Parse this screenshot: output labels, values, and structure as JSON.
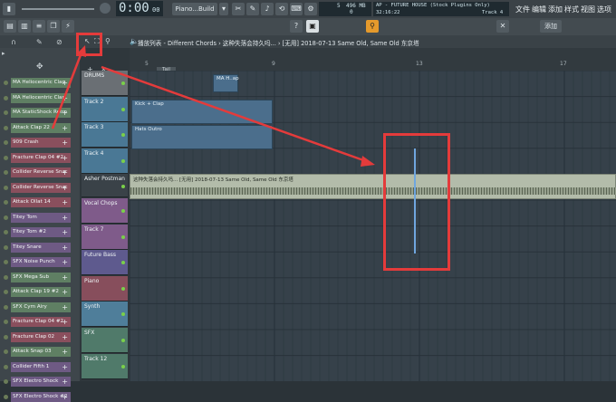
{
  "transport": {
    "time": "0:00",
    "time_sub": "00",
    "pattern": "Piano...Build"
  },
  "stats": {
    "cpu": "5",
    "mem": "496 MB",
    "voices": "0",
    "clock": "32:16:22"
  },
  "hint": {
    "title": "AP - FUTURE HOUSE (Stock Plugins Only)",
    "track": "Track 4"
  },
  "menu": [
    "文件",
    "编辑",
    "添加",
    "样式",
    "视图",
    "选项"
  ],
  "toolbar2": {
    "add_label": "添加"
  },
  "playlist": {
    "breadcrumb": "播放列表 - Different Chords › 这种失落会持久吗... › [无用] 2018-07-13 Same Old, Same Old 东京塔",
    "ruler_marks": [
      "5",
      "9",
      "13",
      "17"
    ],
    "tab_label": "Tail"
  },
  "channels": [
    {
      "name": "MA Heliocentric Clap",
      "color": "#5f7f63"
    },
    {
      "name": "MA Heliocentric Clap",
      "color": "#5f7f63"
    },
    {
      "name": "MA StaticShock Retro",
      "color": "#5f7f63"
    },
    {
      "name": "Attack Clap 22",
      "color": "#5f7f63"
    },
    {
      "name": "909 Crash",
      "color": "#8a4f5d"
    },
    {
      "name": "Fracture Clap 04 #2",
      "color": "#8a4f5d"
    },
    {
      "name": "Collider Reverse Snar",
      "color": "#8a4f5d"
    },
    {
      "name": "Collider Reverse Snar",
      "color": "#8a4f5d"
    },
    {
      "name": "Attack Ollat 14",
      "color": "#8a4f5d"
    },
    {
      "name": "Titey Tom",
      "color": "#6e5a84"
    },
    {
      "name": "Titey Tom #2",
      "color": "#6e5a84"
    },
    {
      "name": "Titey Snare",
      "color": "#6e5a84"
    },
    {
      "name": "SFX Noise Punch",
      "color": "#6e5a84"
    },
    {
      "name": "SFX Mega Sub",
      "color": "#5f7f63"
    },
    {
      "name": "Attack Clap 19 #2",
      "color": "#5f7f63"
    },
    {
      "name": "SFX Cym Airy",
      "color": "#5f7f63"
    },
    {
      "name": "Fracture Clap 04 #2",
      "color": "#8a4f5d"
    },
    {
      "name": "Fracture Clap 02",
      "color": "#8a4f5d"
    },
    {
      "name": "Attack Snap 03",
      "color": "#5f7f63"
    },
    {
      "name": "Collider Fifth 1",
      "color": "#6e5a84"
    },
    {
      "name": "SFX Electro Shock",
      "color": "#6e5a84"
    },
    {
      "name": "SFX Electro Shock #2",
      "color": "#6e5a84"
    }
  ],
  "tracks": [
    {
      "name": "DRUMS",
      "color": "#6a6f74"
    },
    {
      "name": "Track 2",
      "color": "#4a7895"
    },
    {
      "name": "Track 3",
      "color": "#4a7895"
    },
    {
      "name": "Track 4",
      "color": "#4a7895"
    },
    {
      "name": "Asher Postman",
      "color": "#3a4248"
    },
    {
      "name": "Vocal Chops",
      "color": "#7f5b8a"
    },
    {
      "name": "Track 7",
      "color": "#7f5b8a"
    },
    {
      "name": "Future Bass",
      "color": "#5e5a8e"
    },
    {
      "name": "Piano",
      "color": "#874e5c"
    },
    {
      "name": "Synth",
      "color": "#4f7e9a"
    },
    {
      "name": "SFX",
      "color": "#507a6a"
    },
    {
      "name": "Track 12",
      "color": "#507a6a"
    }
  ],
  "clips": {
    "ma": "MA H..ap",
    "kick": "Kick + Clap",
    "hats": "Hats Outro",
    "audio": "这种失落会持久吗...  [无用]  2018-07-13 Same Old, Same Old 东京塔"
  }
}
